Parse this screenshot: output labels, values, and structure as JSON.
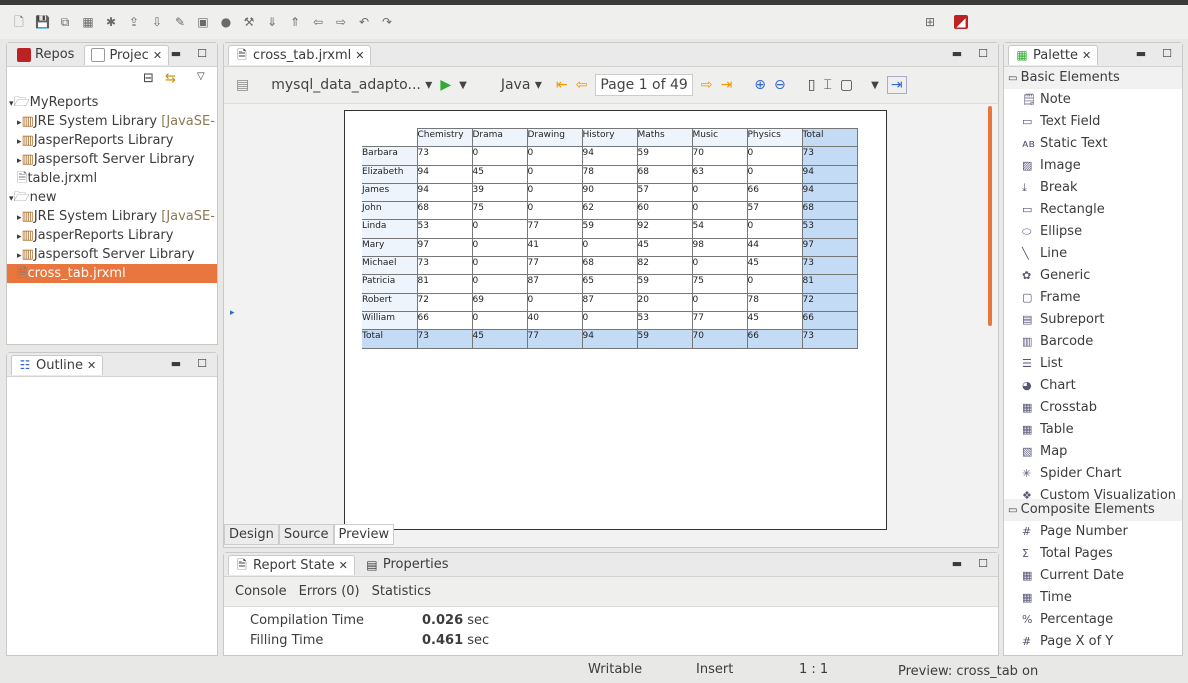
{
  "toolbar": {
    "icons": [
      "new-icon",
      "save-icon",
      "save-all-icon",
      "binary-icon",
      "debug-icon",
      "publish-icon",
      "export-icon",
      "edit-icon",
      "deploy-icon",
      "run-icon",
      "wand-icon",
      "next-annotation-icon",
      "prev-annotation-icon",
      "back-icon",
      "forward-icon",
      "undo-icon",
      "redo-icon",
      "perspective-icon",
      "jaspersoft-icon"
    ]
  },
  "left": {
    "tabs": [
      "Repos",
      "Projec"
    ],
    "tree": [
      {
        "label": "MyReports",
        "level": 0,
        "type": "folder",
        "open": true
      },
      {
        "label": "JRE System Library",
        "suffix": " [JavaSE-",
        "level": 1,
        "type": "lib"
      },
      {
        "label": "JasperReports Library",
        "level": 1,
        "type": "lib"
      },
      {
        "label": "Jaspersoft Server Library",
        "level": 1,
        "type": "lib"
      },
      {
        "label": "table.jrxml",
        "level": 1,
        "type": "file"
      },
      {
        "label": "new",
        "level": 0,
        "type": "folder",
        "open": true
      },
      {
        "label": "JRE System Library",
        "suffix": " [JavaSE-",
        "level": 1,
        "type": "lib"
      },
      {
        "label": "JasperReports Library",
        "level": 1,
        "type": "lib"
      },
      {
        "label": "Jaspersoft Server Library",
        "level": 1,
        "type": "lib"
      },
      {
        "label": "cross_tab.jrxml",
        "level": 1,
        "type": "file",
        "selected": true
      }
    ],
    "outline_tab": "Outline"
  },
  "editor": {
    "tab": "cross_tab.jrxml",
    "adapter": "mysql_data_adapto...",
    "language": "Java",
    "page": "Page 1 of 49",
    "bottom_tabs": [
      "Design",
      "Source",
      "Preview"
    ],
    "active_bottom": "Preview"
  },
  "crosstab": {
    "columns": [
      "Chemistry",
      "Drama",
      "Drawing",
      "History",
      "Maths",
      "Music",
      "Physics",
      "Total"
    ],
    "rows": [
      {
        "name": "Barbara",
        "values": [
          73,
          0,
          0,
          94,
          59,
          70,
          0,
          73
        ]
      },
      {
        "name": "Elizabeth",
        "values": [
          94,
          45,
          0,
          78,
          68,
          63,
          0,
          94
        ]
      },
      {
        "name": "James",
        "values": [
          94,
          39,
          0,
          90,
          57,
          0,
          66,
          94
        ]
      },
      {
        "name": "John",
        "values": [
          68,
          75,
          0,
          62,
          60,
          0,
          57,
          68
        ]
      },
      {
        "name": "Linda",
        "values": [
          53,
          0,
          77,
          59,
          92,
          54,
          0,
          53
        ]
      },
      {
        "name": "Mary",
        "values": [
          97,
          0,
          41,
          0,
          45,
          98,
          44,
          97
        ]
      },
      {
        "name": "Michael",
        "values": [
          73,
          0,
          77,
          68,
          82,
          0,
          45,
          73
        ]
      },
      {
        "name": "Patricia",
        "values": [
          81,
          0,
          87,
          65,
          59,
          75,
          0,
          81
        ]
      },
      {
        "name": "Robert",
        "values": [
          72,
          69,
          0,
          87,
          20,
          0,
          78,
          72
        ]
      },
      {
        "name": "William",
        "values": [
          66,
          0,
          40,
          0,
          53,
          77,
          45,
          66
        ]
      },
      {
        "name": "Total",
        "values": [
          73,
          45,
          77,
          94,
          59,
          70,
          66,
          73
        ]
      }
    ]
  },
  "bottom": {
    "tabs": [
      "Report State",
      "Properties"
    ],
    "subtabs": [
      "Console",
      "Errors (0)",
      "Statistics"
    ],
    "stats": [
      {
        "label": "Compilation Time",
        "value": "0.026",
        "unit": "sec"
      },
      {
        "label": "Filling Time",
        "value": "0.461",
        "unit": "sec"
      }
    ]
  },
  "palette": {
    "tab": "Palette",
    "basic_header": "Basic Elements",
    "basic": [
      "Note",
      "Text Field",
      "Static Text",
      "Image",
      "Break",
      "Rectangle",
      "Ellipse",
      "Line",
      "Generic",
      "Frame",
      "Subreport",
      "Barcode",
      "List",
      "Chart",
      "Crosstab",
      "Table",
      "Map",
      "Spider Chart",
      "Custom Visualization"
    ],
    "composite_header": "Composite Elements",
    "composite": [
      "Page Number",
      "Total Pages",
      "Current Date",
      "Time",
      "Percentage",
      "Page X of Y"
    ]
  },
  "status": {
    "mode": "Writable",
    "insert": "Insert",
    "position": "1 : 1",
    "message": "Preview: cross_tab on"
  }
}
